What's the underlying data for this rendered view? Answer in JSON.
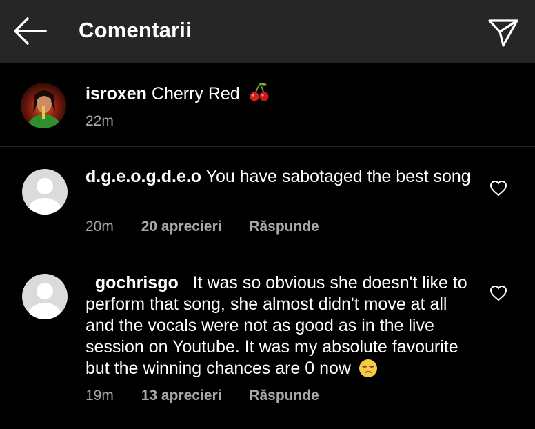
{
  "header": {
    "title": "Comentarii",
    "back_icon": "arrow-left-icon",
    "send_icon": "paper-plane-icon"
  },
  "caption": {
    "username": "isroxen",
    "text": "Cherry Red",
    "emoji": "cherries-emoji",
    "time": "22m"
  },
  "comments": [
    {
      "username": "d.g.e.o.g.d.e.o",
      "text": "You have sabotaged the best song",
      "time": "20m",
      "likes": "20 aprecieri",
      "reply": "Răspunde"
    },
    {
      "username": "_gochrisgo_",
      "text": "It was so obvious she doesn't like to perform that song, she almost didn't move at all and the vocals were not as good as in the live session on Youtube. It was my absolute favourite but the winning chances are 0 now",
      "emoji": "pensive-face-emoji",
      "time": "19m",
      "likes": "13 aprecieri",
      "reply": "Răspunde"
    }
  ],
  "colors": {
    "background": "#000000",
    "header": "#262626",
    "text": "#ffffff",
    "secondary_text": "#a8a8a8",
    "divider": "#262626",
    "avatar_placeholder": "#dbdbdb"
  }
}
